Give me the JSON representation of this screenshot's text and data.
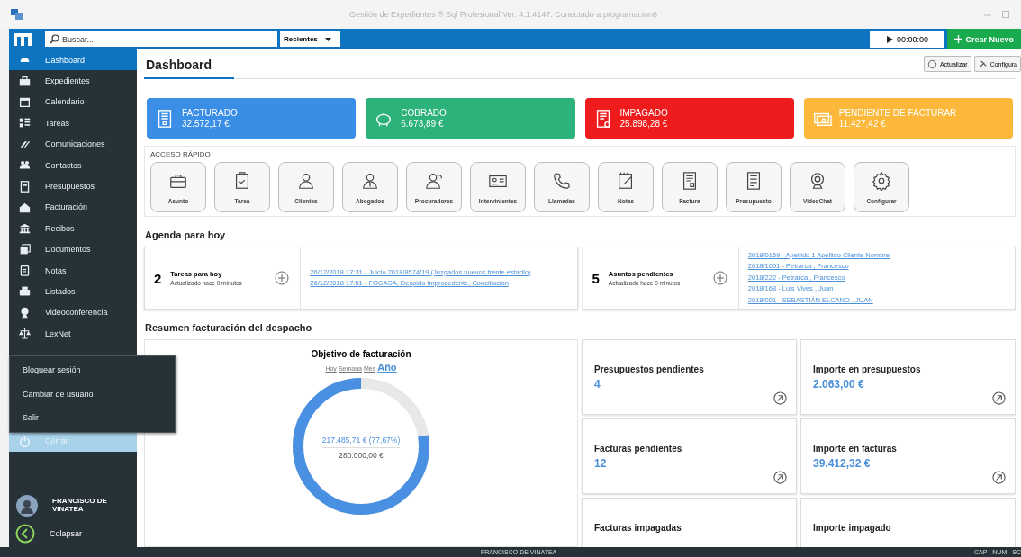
{
  "window": {
    "title": "Gestión de Expedientes ® Sql Profesional Ver. 4.1.4147. Conectado a programacion6"
  },
  "toolbar": {
    "search": {
      "placeholder": "Buscar..."
    },
    "recent": "Recientes",
    "timer": "00:00:00",
    "create": "Crear Nuevo"
  },
  "sidebar": {
    "items": [
      {
        "label": "Dashboard",
        "selected": true
      },
      {
        "label": "Expedientes",
        "selected": false
      },
      {
        "label": "Calendario",
        "selected": false
      },
      {
        "label": "Tareas",
        "selected": false
      },
      {
        "label": "Comunicaciones",
        "selected": false
      },
      {
        "label": "Contactos",
        "selected": false
      },
      {
        "label": "Presupuestos",
        "selected": false
      },
      {
        "label": "Facturación",
        "selected": false
      },
      {
        "label": "Recibos",
        "selected": false
      },
      {
        "label": "Documentos",
        "selected": false
      },
      {
        "label": "Notas",
        "selected": false
      },
      {
        "label": "Listados",
        "selected": false
      },
      {
        "label": "Videoconferencia",
        "selected": false
      },
      {
        "label": "LexNet",
        "selected": false
      }
    ],
    "popup_menu": [
      "Bloquear sesión",
      "Cambiar de usuario",
      "Salir"
    ],
    "close": {
      "label": "Cerrar",
      "selected": true
    },
    "user": "FRANCISCO DE VINATEA",
    "collapse": "Colapsar"
  },
  "page_tab": "Dashboard",
  "header_buttons": [
    "Actualizar",
    "Configura"
  ],
  "stat_cards": [
    {
      "label": "FACTURADO",
      "amount": "32.572,17 €",
      "color": "#3a8ee6"
    },
    {
      "label": "COBRADO",
      "amount": "6.673,89 €",
      "color": "#2db27a"
    },
    {
      "label": "IMPAGADO",
      "amount": "25.898,28 €",
      "color": "#ee1c1c"
    },
    {
      "label": "PENDIENTE DE FACTURAR",
      "amount": "11.427,42 €",
      "color": "#fbb83a"
    }
  ],
  "quick_access": {
    "title": "ACCESO RÁPIDO",
    "items": [
      "Asunto",
      "Tarea",
      "Clientes",
      "Abogados",
      "Procuradores",
      "Intervinientes",
      "Llamadas",
      "Notas",
      "Factura",
      "Presupuesto",
      "VideoChat",
      "Configurar"
    ]
  },
  "agenda": {
    "title": "Agenda para hoy",
    "cards": [
      {
        "count": "2",
        "label": "Tareas para hoy",
        "updated": "Actualizado hace 0 minutos",
        "links": [
          "26/12/2018 17:31 - Juicio 2018/8574/19 (Juzgados nuevos frente estadio)",
          "26/12/2018 17:51 - FOGASA, Despido Improcedente, Conciliación"
        ]
      },
      {
        "count": "5",
        "label": "Asuntos pendientes",
        "updated": "Actualizado hace 0 minutos",
        "links": [
          "2018/0159 - Apellido 1 Apellido Cliente Nombre",
          "2018/1001 - Petrarca , Francesco",
          "2018/222 - Petrarca , Francesco",
          "2018/168 - Luis Vives , Juan",
          "2018/001 - SEBASTIÁN ELCANO , JUAN"
        ]
      }
    ]
  },
  "summary": {
    "title": "Resumen facturación del despacho",
    "goal": {
      "title": "Objetivo de facturación",
      "periods": [
        {
          "label": "Hoy",
          "selected": false
        },
        {
          "label": "Semana",
          "selected": false
        },
        {
          "label": "Mes",
          "selected": false
        },
        {
          "label": "Año",
          "selected": true
        }
      ],
      "level": 0.7767,
      "achieved": "217.485,71 € (77,67%)",
      "target": "280.000,00 €"
    },
    "tiles": [
      {
        "label": "Presupuestos pendientes",
        "value": "4"
      },
      {
        "label": "Importe en presupuestos",
        "value": "2.063,00 €"
      },
      {
        "label": "Facturas pendientes",
        "value": "12"
      },
      {
        "label": "Importe en facturas",
        "value": "39.412,32 €"
      },
      {
        "label": "Facturas impagadas"
      },
      {
        "label": "Importe impagado"
      }
    ]
  },
  "status_bar": {
    "user": "FRANCISCO DE VINATEA",
    "indicators": [
      "CAP",
      "NUM",
      "SC"
    ]
  }
}
